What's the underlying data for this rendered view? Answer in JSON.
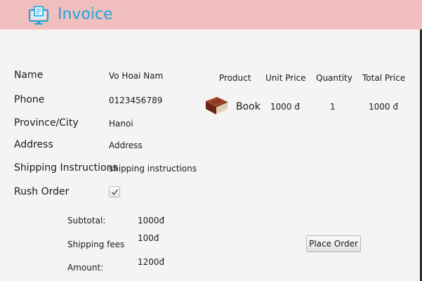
{
  "header": {
    "title": "Invoice",
    "icon": "invoice-monitor-icon",
    "background": "#f0bfbd",
    "title_color": "#1ea3dd"
  },
  "customer": {
    "name_label": "Name",
    "name_value": "Vo Hoai Nam",
    "phone_label": "Phone",
    "phone_value": "0123456789",
    "province_label": "Province/City",
    "province_value": "Hanoi",
    "address_label": "Address",
    "address_value": "Address",
    "instructions_label": "Shipping Instructions",
    "instructions_value": "shipping instructions",
    "rush_label": "Rush Order",
    "rush_checked": true
  },
  "table": {
    "headers": [
      "Product",
      "Unit Price",
      "Quantity",
      "Total Price"
    ],
    "rows": [
      {
        "icon": "book-icon",
        "product": "Book",
        "unit_price": "1000 đ",
        "quantity": "1",
        "total_price": "1000 đ"
      }
    ]
  },
  "totals": {
    "subtotal_label": "Subtotal:",
    "subtotal_value": "1000đ",
    "shipping_label": "Shipping fees",
    "shipping_value": "100đ",
    "amount_label": "Amount:",
    "amount_value": "1200đ"
  },
  "actions": {
    "place_order_label": "Place Order"
  }
}
